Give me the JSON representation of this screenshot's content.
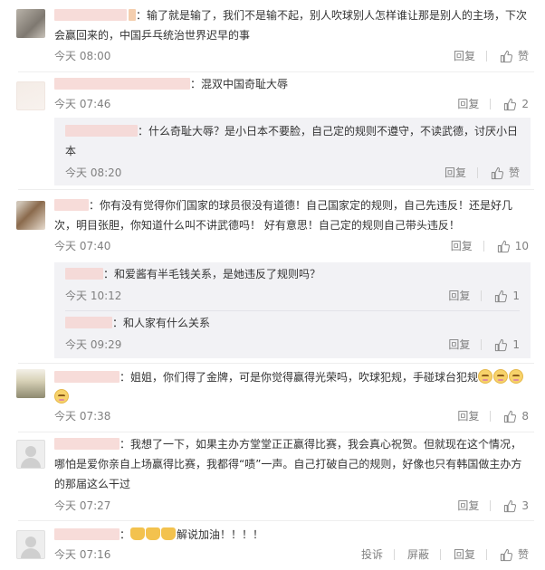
{
  "comments": [
    {
      "text_after_name": "输了就是输了，我们不是输不起，别人吹球别人怎样谁让那是别人的主场，下次会赢回来的，中国乒乓统治世界迟早的事",
      "time": "今天 08:00",
      "reply_label": "回复",
      "like_label": "赞"
    },
    {
      "text_after_name": "混双中国奇耻大辱",
      "time": "今天 07:46",
      "reply_label": "回复",
      "like_count": "2",
      "sub": {
        "text_after_name": "什么奇耻大辱？是小日本不要脸，自己定的规则不遵守，不读武德，讨厌小日本",
        "time": "今天 08:20",
        "reply_label": "回复",
        "like_label": "赞"
      }
    },
    {
      "text_after_name": "你有没有觉得你们国家的球员很没有道德！自己国家定的规则，自己先违反！还是好几次，明目张胆，你知道什么叫不讲武德吗！ 好有意思！自己定的规则自己带头违反！",
      "time": "今天 07:40",
      "reply_label": "回复",
      "like_count": "10",
      "subs": [
        {
          "text_after_name": "和爱酱有半毛钱关系，是她违反了规则吗？",
          "time": "今天 10:12",
          "reply_label": "回复",
          "like_count": "1"
        },
        {
          "text_after_name": "和人家有什么关系",
          "time": "今天 09:29",
          "reply_label": "回复",
          "like_count": "1"
        }
      ]
    },
    {
      "text_after_name": "姐姐，你们得了金牌，可是你觉得赢得光荣吗，吹球犯规，手碰球台犯规",
      "time": "今天 07:38",
      "reply_label": "回复",
      "like_count": "8"
    },
    {
      "text_after_name": "我想了一下，如果主办方堂堂正正赢得比赛，我会真心祝贺。但就现在这个情况，哪怕是爱你亲自上场赢得比赛，我都得“啧”一声。自己打破自己的规则，好像也只有韩国做主办方的那届这么干过",
      "time": "今天 07:27",
      "reply_label": "回复",
      "like_count": "3"
    },
    {
      "text_after_name": "解说加油！！！！",
      "time": "今天 07:16",
      "report_label": "投诉",
      "block_label": "屏蔽",
      "reply_label": "回复",
      "like_label": "赞"
    }
  ],
  "icons": {
    "like": "thumbs-up-icon",
    "emoji": "smiley-emoji-icon",
    "clap": "clap-emoji-icon",
    "avatar_default": "default-avatar-icon"
  },
  "colors": {
    "meta_text": "#808080",
    "sub_background": "#f2f2f5",
    "divider": "#eeeeee"
  }
}
